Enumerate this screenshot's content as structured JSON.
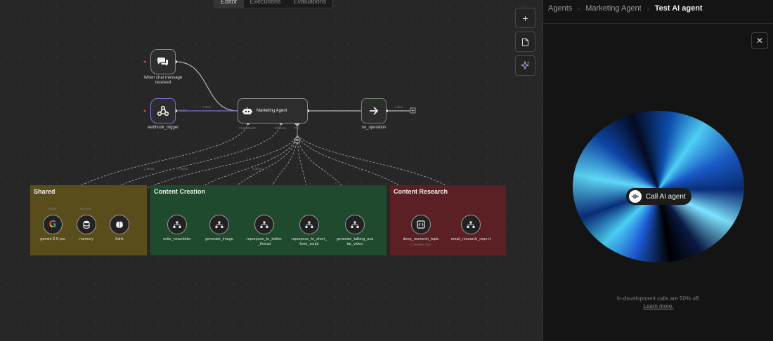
{
  "tabs": [
    {
      "label": "Editor",
      "active": true
    },
    {
      "label": "Executions"
    },
    {
      "label": "Evaluations"
    }
  ],
  "canvas_buttons": {
    "add": "+",
    "note_icon": "document-icon",
    "ai_icon": "sparkle-icon"
  },
  "nodes": {
    "chat_trigger": {
      "label": "When chat message received",
      "icon": "chat-icon"
    },
    "webhook": {
      "label": "webhook_trigger",
      "port_label": "POST",
      "icon": "webhook-icon"
    },
    "agent": {
      "label": "Marketing Agent",
      "icon": "robot-icon",
      "port_chat_model": "Chat Model*",
      "port_memory": "Memory",
      "port_tool": "Tool"
    },
    "noop": {
      "label": "no_operation",
      "icon": "arrow-right-icon"
    }
  },
  "edge_labels": {
    "webhook_to_agent": "1 item",
    "agent_to_noop": "1 item",
    "to_gemini": "2 items",
    "to_memory": "2 items",
    "to_tools": "4 items"
  },
  "groups": [
    {
      "title": "Shared",
      "color": "#5a4d1c",
      "tools": [
        {
          "label": "gemini-2.5-pro",
          "icon": "google-icon",
          "top_label": "Model"
        },
        {
          "label": "memory",
          "icon": "database-icon",
          "top_label": "Memory"
        },
        {
          "label": "think",
          "icon": "brain-icon",
          "top_label": ""
        }
      ]
    },
    {
      "title": "Content Creation",
      "color": "#1f4a2d",
      "tools": [
        {
          "label": "write_newsletter",
          "icon": "workflow-icon"
        },
        {
          "label": "generate_image",
          "icon": "workflow-icon"
        },
        {
          "label": "repurpose_to_twitter _thread",
          "icon": "workflow-icon"
        },
        {
          "label": "repurpose_to_short_ form_script",
          "icon": "workflow-icon"
        },
        {
          "label": "generate_talking_ava tar_video",
          "icon": "workflow-icon"
        }
      ]
    },
    {
      "title": "Content Research",
      "color": "#5a2024",
      "tools": [
        {
          "label": "deep_research_topic",
          "sublabel": "Complete chat",
          "icon": "code-icon"
        },
        {
          "label": "email_research_repo rt",
          "icon": "workflow-icon"
        }
      ]
    }
  ],
  "panel": {
    "breadcrumbs": [
      "Agents",
      "Marketing Agent",
      "Test AI agent"
    ],
    "close": "✕",
    "call_button": "Call AI agent",
    "call_icon": "voice-wave-icon",
    "note_line1": "In-development calls are 50% off.",
    "note_link": "Learn more."
  }
}
